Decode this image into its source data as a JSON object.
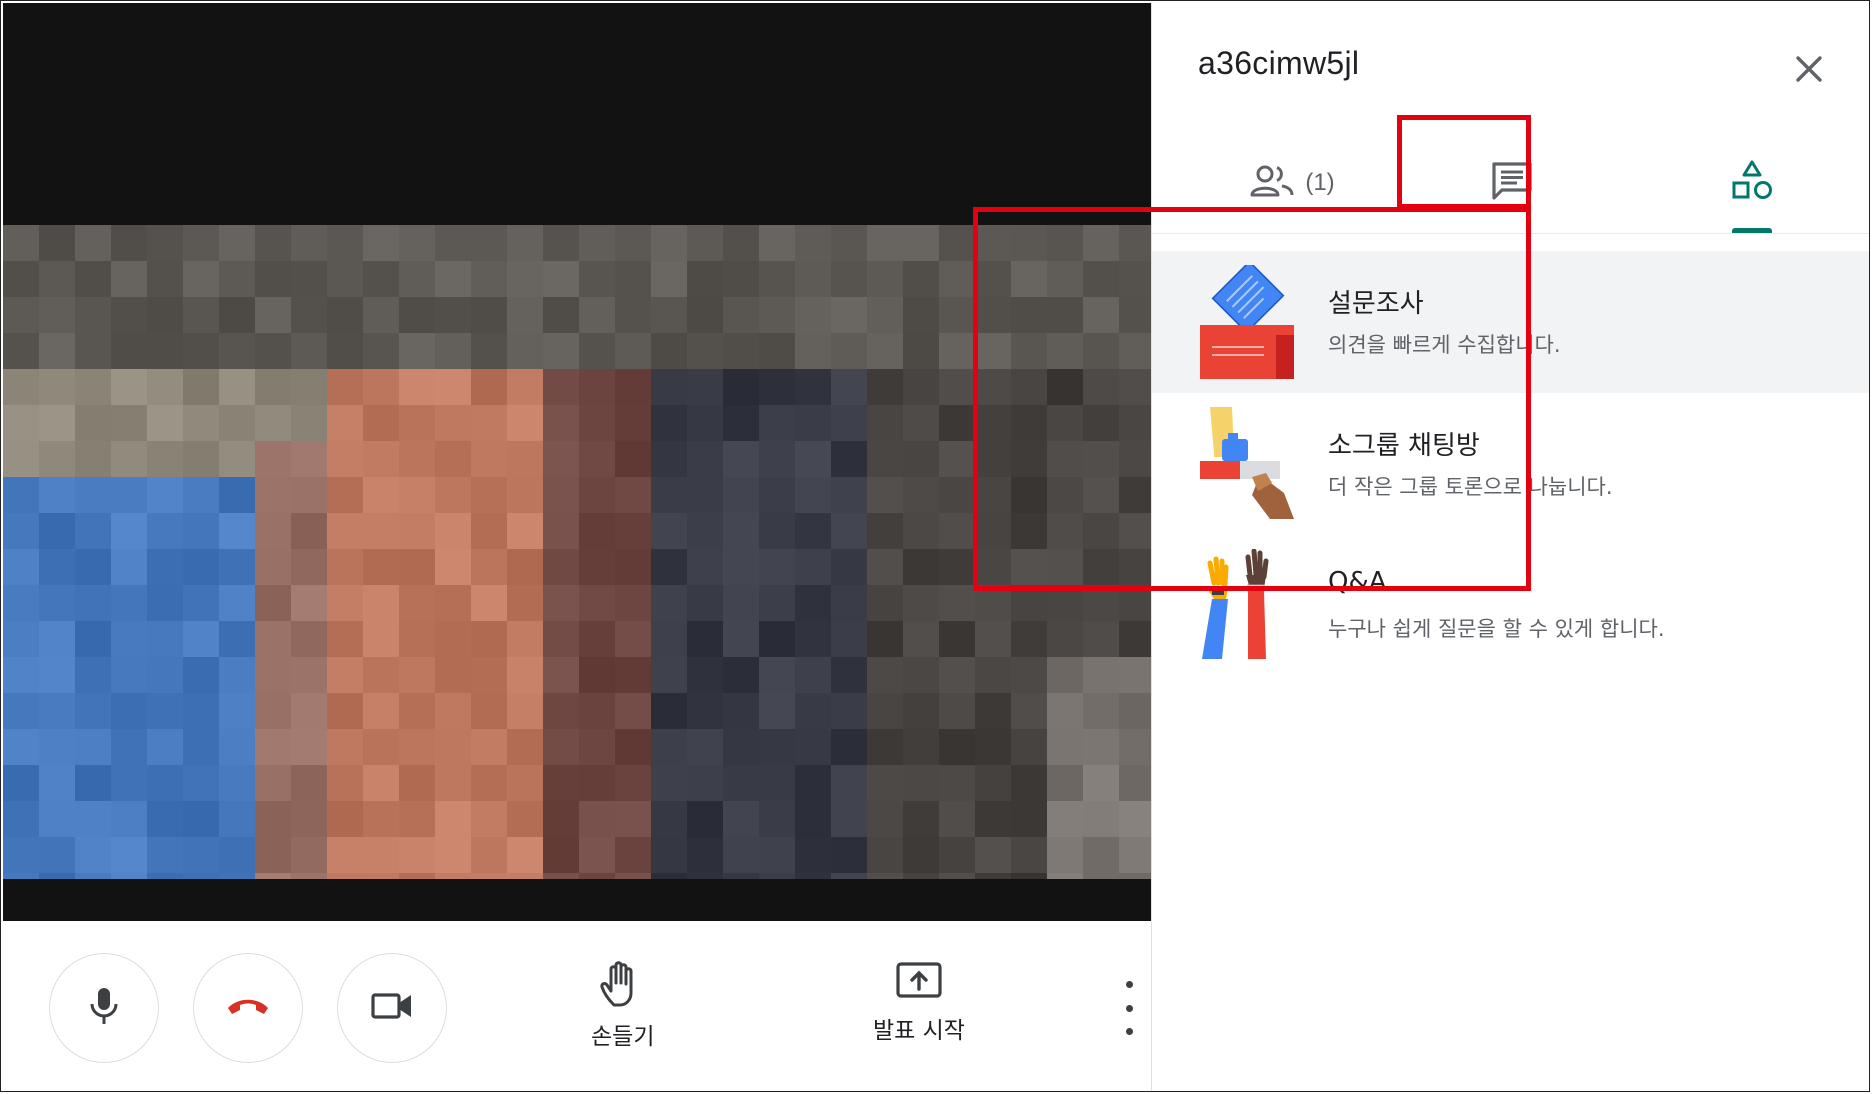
{
  "meeting": {
    "code": "a36cimw5jl"
  },
  "tabs": [
    {
      "name": "people",
      "count": "(1)"
    },
    {
      "name": "chat"
    },
    {
      "name": "activities",
      "selected": true
    }
  ],
  "activities": [
    {
      "title": "설문조사",
      "description": "의견을 빠르게 수집합니다.",
      "icon": "poll-illustration"
    },
    {
      "title": "소그룹 채팅방",
      "description": "더 작은 그룹 토론으로 나눕니다.",
      "icon": "breakout-rooms-illustration"
    },
    {
      "title": "Q&A",
      "description": "누구나 쉽게 질문을 할 수 있게 합니다.",
      "icon": "qa-illustration"
    }
  ],
  "controls": {
    "raise_hand_label": "손들기",
    "present_label": "발표 시작"
  },
  "colors": {
    "accent": "#00796b",
    "end_call": "#d93025",
    "highlight": "#e3000f"
  }
}
